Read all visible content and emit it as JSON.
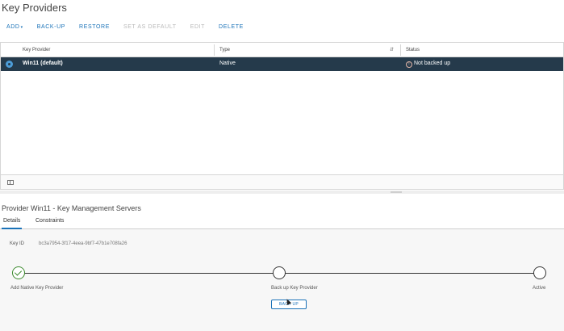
{
  "page": {
    "title": "Key Providers"
  },
  "toolbar": {
    "add": "ADD",
    "backup": "BACK-UP",
    "restore": "RESTORE",
    "set_default": "SET AS DEFAULT",
    "edit": "EDIT",
    "delete": "DELETE"
  },
  "grid": {
    "columns": [
      "Key Provider",
      "Type",
      "Status"
    ],
    "rows": [
      {
        "provider": "Win11 (default)",
        "type": "Native",
        "status": "Not backed up",
        "selected": true
      }
    ]
  },
  "detail": {
    "title": "Provider Win11 - Key Management Servers",
    "tabs": [
      "Details",
      "Constraints"
    ],
    "active_tab": "Details",
    "key_id_label": "Key ID",
    "key_id_value": "bc3a7954-3f17-4eea-9bf7-47b1e708fa26",
    "steps": [
      {
        "label": "Add Native Key Provider",
        "state": "done"
      },
      {
        "label": "Back up Key Provider",
        "state": "pending"
      },
      {
        "label": "Active",
        "state": "pending"
      }
    ],
    "backup_button": "BACK UP"
  },
  "colors": {
    "accent": "#1a72b8",
    "row_selected": "#253a4b",
    "success": "#3c8a2e"
  },
  "icons": [
    "chevron-down-icon",
    "radio-selected-icon",
    "warning-circle-icon",
    "sort-icon",
    "column-toggle-icon",
    "check-icon",
    "cursor-icon"
  ]
}
